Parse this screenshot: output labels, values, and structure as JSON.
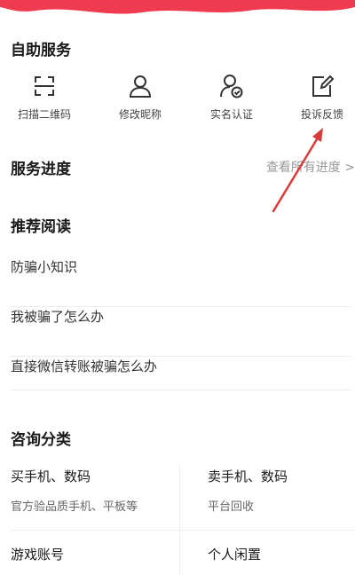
{
  "self_service": {
    "title": "自助服务",
    "items": [
      {
        "label": "扫描二维码",
        "icon": "scan-icon"
      },
      {
        "label": "修改昵称",
        "icon": "user-icon"
      },
      {
        "label": "实名认证",
        "icon": "verified-user-icon"
      },
      {
        "label": "投诉反馈",
        "icon": "edit-note-icon"
      }
    ]
  },
  "progress": {
    "title": "服务进度",
    "link": "查看所有进度 >"
  },
  "reading": {
    "title": "推荐阅读",
    "items": [
      "防骗小知识",
      "我被骗了怎么办",
      "直接微信转账被骗怎么办"
    ]
  },
  "consult": {
    "title": "咨询分类",
    "categories": [
      {
        "title": "买手机、数码",
        "subtitle": "官方验品质手机、平板等"
      },
      {
        "title": "卖手机、数码",
        "subtitle": "平台回收"
      },
      {
        "title": "游戏账号",
        "subtitle": ""
      },
      {
        "title": "个人闲置",
        "subtitle": ""
      }
    ]
  },
  "colors": {
    "accent_red": "#e8334a",
    "arrow_red": "#d93a3a",
    "text_gray": "#999999"
  }
}
